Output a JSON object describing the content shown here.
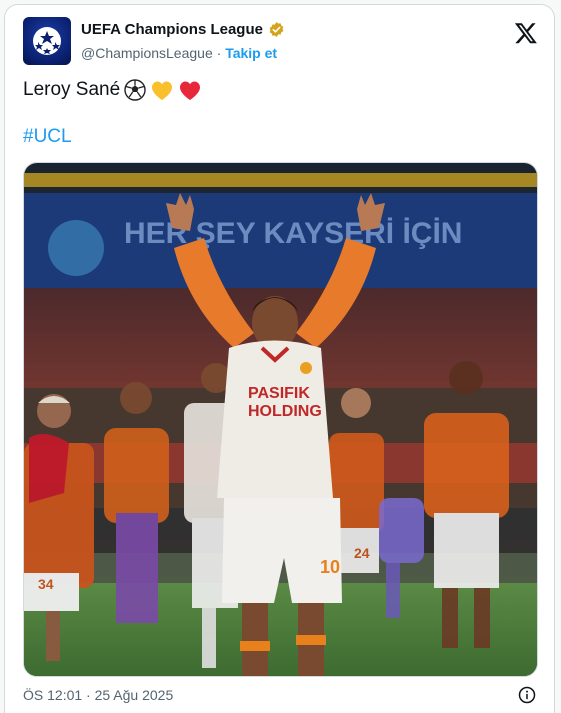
{
  "account": {
    "name": "UEFA Champions League",
    "handle": "@ChampionsLeague",
    "separator": " · ",
    "follow_label": "Takip et",
    "verified_color": "#d4a41c"
  },
  "tweet": {
    "text": "Leroy Sané",
    "emojis": [
      "soccer-ball-icon",
      "yellow-heart-icon",
      "red-heart-icon"
    ],
    "hashtag": "#UCL"
  },
  "photo": {
    "banner_text": "HER ŞEY KAYSERİ İÇİN",
    "shirt_sponsor_line1": "PASIFIK",
    "shirt_sponsor_line2": "HOLDING",
    "shorts_number": "10",
    "player_number_left": "34",
    "player_number_right": "24"
  },
  "footer": {
    "timestamp": "ÖS 12:01 · 25 Ağu 2025"
  },
  "colors": {
    "accent": "#1d9bf0",
    "kit_orange": "#e86a1c",
    "pitch": "#4a7a3a"
  }
}
